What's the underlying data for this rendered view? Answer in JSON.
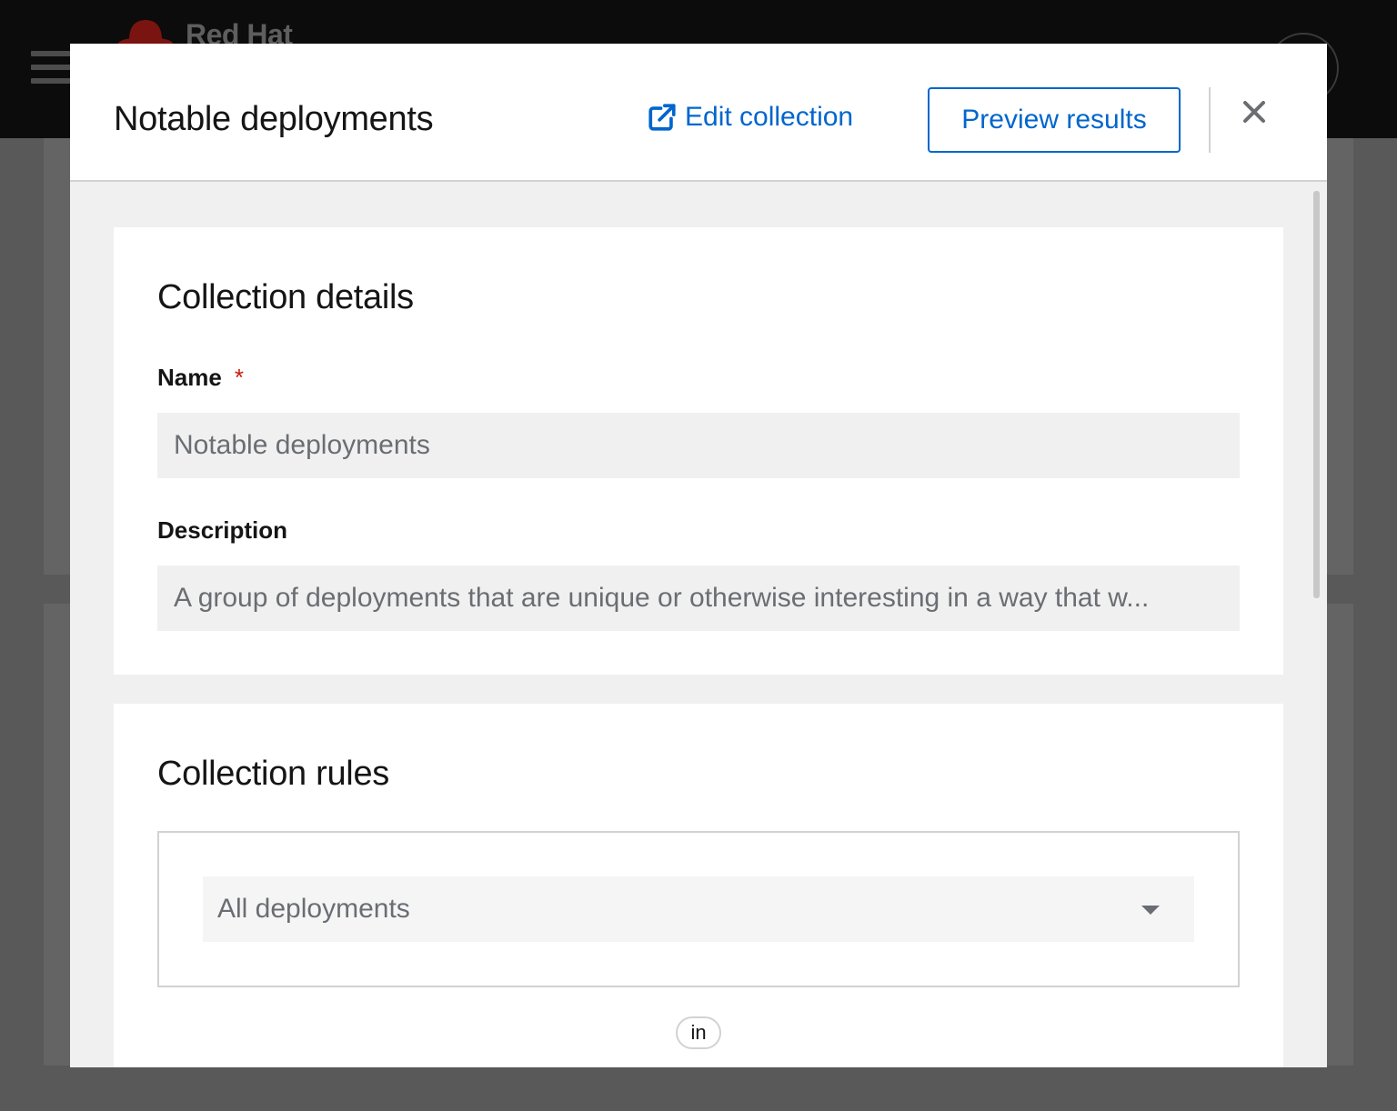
{
  "background": {
    "brand_name": "Red Hat"
  },
  "modal": {
    "title": "Notable deployments",
    "edit_link_label": "Edit collection",
    "preview_button_label": "Preview results"
  },
  "details": {
    "heading": "Collection details",
    "name_label": "Name",
    "required_marker": "*",
    "name_value": "Notable deployments",
    "description_label": "Description",
    "description_value": "A group of deployments that are unique or otherwise interesting in a way that w..."
  },
  "rules": {
    "heading": "Collection rules",
    "selector_value": "All deployments",
    "conjunction": "in"
  },
  "colors": {
    "link": "#0066cc",
    "required": "#c9190b",
    "brand_red": "#7a1410"
  },
  "icons": {
    "menu": "hamburger-icon",
    "external_link": "external-link-icon",
    "close": "close-icon",
    "caret": "caret-down-icon"
  }
}
